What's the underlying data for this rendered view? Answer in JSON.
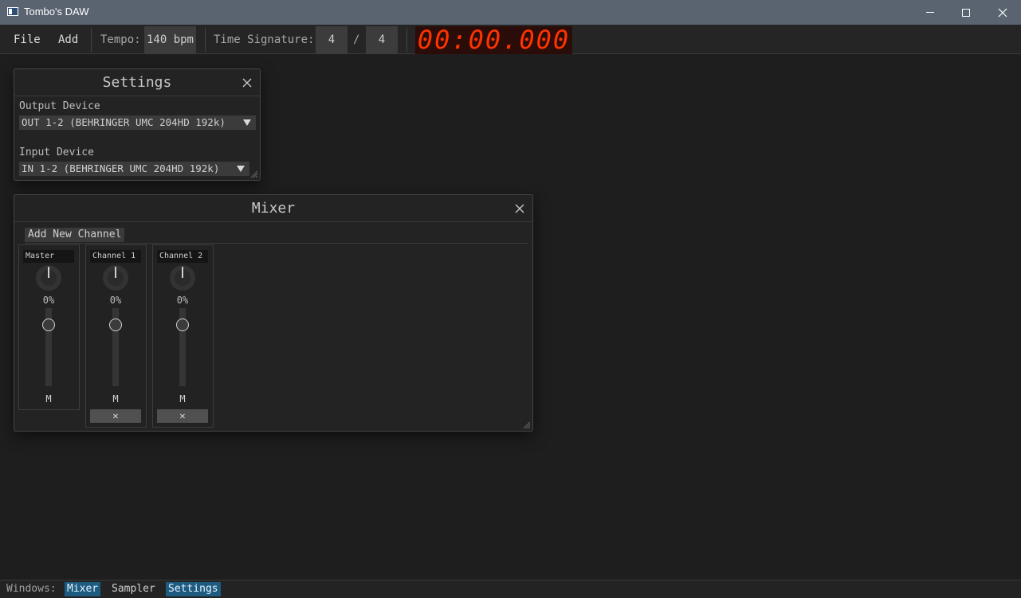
{
  "window": {
    "title": "Tombo's DAW"
  },
  "menu": {
    "file": "File",
    "add": "Add"
  },
  "transport": {
    "tempo_label": "Tempo:",
    "tempo_value": "140 bpm",
    "time_sig_label": "Time Signature:",
    "time_sig_numerator": "4",
    "time_sig_slash": "/",
    "time_sig_denominator": "4",
    "time_display": "00:00.000",
    "time_display_color": "#ff3300"
  },
  "settings": {
    "title": "Settings",
    "output_label": "Output Device",
    "output_value": "OUT 1-2 (BEHRINGER UMC 204HD 192k)",
    "input_label": "Input Device",
    "input_value": "IN 1-2 (BEHRINGER UMC 204HD 192k)"
  },
  "mixer": {
    "title": "Mixer",
    "add_channel_label": "Add New Channel",
    "channels": [
      {
        "name": "Master",
        "volume": "0%",
        "mute_label": "M",
        "deletable": false
      },
      {
        "name": "Channel 1",
        "volume": "0%",
        "mute_label": "M",
        "deletable": true,
        "delete_label": "✕"
      },
      {
        "name": "Channel 2",
        "volume": "0%",
        "mute_label": "M",
        "deletable": true,
        "delete_label": "✕"
      }
    ]
  },
  "bottom_bar": {
    "label": "Windows:",
    "items": [
      {
        "label": "Mixer",
        "active": true
      },
      {
        "label": "Sampler",
        "active": false
      },
      {
        "label": "Settings",
        "active": true
      }
    ],
    "active_color": "#1d5b80"
  }
}
